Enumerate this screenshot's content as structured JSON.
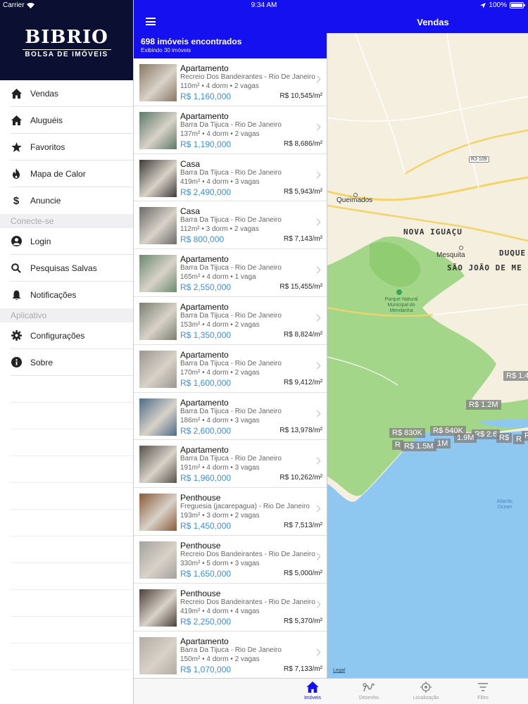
{
  "status": {
    "carrier": "Carrier",
    "time": "9:34 AM",
    "battery": "100%"
  },
  "brand": {
    "name": "BIBRIO",
    "tagline": "BOLSA DE IMÓVEIS"
  },
  "menu": {
    "main": [
      {
        "label": "Vendas",
        "icon": "home-icon"
      },
      {
        "label": "Aluguéis",
        "icon": "home-icon"
      },
      {
        "label": "Favoritos",
        "icon": "star-icon"
      },
      {
        "label": "Mapa de Calor",
        "icon": "flame-icon"
      },
      {
        "label": "Anuncie",
        "icon": "dollar-icon"
      }
    ],
    "section_connect": "Conecte-se",
    "connect": [
      {
        "label": "Login",
        "icon": "user-icon"
      },
      {
        "label": "Pesquisas Salvas",
        "icon": "search-icon"
      },
      {
        "label": "Notificações",
        "icon": "bell-icon"
      }
    ],
    "section_app": "Aplicativo",
    "app": [
      {
        "label": "Configurações",
        "icon": "gear-icon"
      },
      {
        "label": "Sobre",
        "icon": "info-icon"
      }
    ]
  },
  "header": {
    "title": "Vendas"
  },
  "results": {
    "count": "698 imóveis encontrados",
    "showing": "Exibindo 30 imóveis"
  },
  "listings": [
    {
      "type": "Apartamento",
      "location": "Recreio Dos Bandeirantes - Rio De Janeiro",
      "details": "110m² • 4 dorm • 2 vagas",
      "price": "R$ 1,160,000",
      "ppm": "R$ 10,545/m²",
      "thumb": "#8a7864"
    },
    {
      "type": "Apartamento",
      "location": "Barra Da Tijuca - Rio De Janeiro",
      "details": "137m² • 4 dorm • 2 vagas",
      "price": "R$ 1,190,000",
      "ppm": "R$ 8,686/m²",
      "thumb": "#5c7a68"
    },
    {
      "type": "Casa",
      "location": "Barra Da Tijuca - Rio De Janeiro",
      "details": "419m² • 4 dorm • 3 vagas",
      "price": "R$ 2,490,000",
      "ppm": "R$ 5,943/m²",
      "thumb": "#3e3a38"
    },
    {
      "type": "Casa",
      "location": "Barra Da Tijuca - Rio De Janeiro",
      "details": "112m² • 3 dorm • 2 vagas",
      "price": "R$ 800,000",
      "ppm": "R$ 7,143/m²",
      "thumb": "#6b6b6b"
    },
    {
      "type": "Apartamento",
      "location": "Barra Da Tijuca - Rio De Janeiro",
      "details": "165m² • 4 dorm • 1 vaga",
      "price": "R$ 2,550,000",
      "ppm": "R$ 15,455/m²",
      "thumb": "#6d8a70"
    },
    {
      "type": "Apartamento",
      "location": "Barra Da Tijuca - Rio De Janeiro",
      "details": "153m² • 4 dorm • 2 vagas",
      "price": "R$ 1,350,000",
      "ppm": "R$ 8,824/m²",
      "thumb": "#7a8070"
    },
    {
      "type": "Apartamento",
      "location": "Barra Da Tijuca - Rio De Janeiro",
      "details": "170m² • 4 dorm • 2 vagas",
      "price": "R$ 1,600,000",
      "ppm": "R$ 9,412/m²",
      "thumb": "#9a9690"
    },
    {
      "type": "Apartamento",
      "location": "Barra Da Tijuca - Rio De Janeiro",
      "details": "186m² • 4 dorm • 3 vagas",
      "price": "R$ 2,600,000",
      "ppm": "R$ 13,978/m²",
      "thumb": "#4d6c88"
    },
    {
      "type": "Apartamento",
      "location": "Barra Da Tijuca - Rio De Janeiro",
      "details": "191m² • 4 dorm • 3 vagas",
      "price": "R$ 1,960,000",
      "ppm": "R$ 10,262/m²",
      "thumb": "#56524c"
    },
    {
      "type": "Penthouse",
      "location": "Freguesia (jacarepagua) - Rio De Janeiro",
      "details": "193m² • 3 dorm • 2 vagas",
      "price": "R$ 1,450,000",
      "ppm": "R$ 7,513/m²",
      "thumb": "#8a5a3a"
    },
    {
      "type": "Penthouse",
      "location": "Recreio Dos Bandeirantes - Rio De Janeiro",
      "details": "330m² • 5 dorm • 3 vagas",
      "price": "R$ 1,650,000",
      "ppm": "R$ 5,000/m²",
      "thumb": "#a4a29e"
    },
    {
      "type": "Penthouse",
      "location": "Recreio Dos Bandeirantes - Rio De Janeiro",
      "details": "419m² • 4 dorm • 4 vagas",
      "price": "R$ 2,250,000",
      "ppm": "R$ 5,370/m²",
      "thumb": "#4a4038"
    },
    {
      "type": "Apartamento",
      "location": "Barra Da Tijuca - Rio De Janeiro",
      "details": "150m² • 4 dorm • 2 vagas",
      "price": "R$ 1,070,000",
      "ppm": "R$ 7,133/m²",
      "thumb": "#b2aca2"
    }
  ],
  "map": {
    "labels": {
      "queimados": "Queimados",
      "nova_iguacu": "NOVA IGUAÇU",
      "mesquita": "Mesquita",
      "duque": "DUQUE",
      "sao_joao": "SÃO JOÃO DE ME",
      "park": "Parque Natural Municipal do Mendanha",
      "ocean": "Atlantic Ocean",
      "road": "RJ-109",
      "legal": "Legal"
    },
    "pins": [
      "R$ 1.4",
      "R$ 1.2M",
      "R$ 830K",
      "R$ 540K",
      "R$ 2.6",
      "R",
      "R$ 1.5M",
      "1M",
      "1.9M",
      "R$",
      "R",
      "R"
    ]
  },
  "tabs": [
    {
      "label": "Imóveis",
      "icon": "home-icon"
    },
    {
      "label": "Desenho",
      "icon": "draw-icon"
    },
    {
      "label": "Localização",
      "icon": "location-icon"
    },
    {
      "label": "Filtro",
      "icon": "filter-icon"
    }
  ]
}
